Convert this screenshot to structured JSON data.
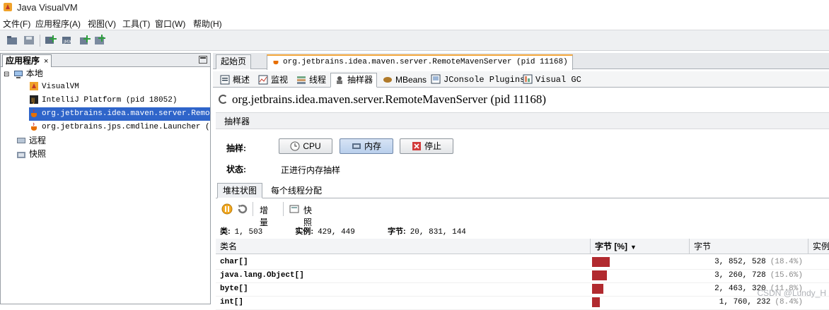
{
  "window": {
    "title": "Java VisualVM"
  },
  "menu": [
    "文件(F)",
    "应用程序(A)",
    "视图(V)",
    "工具(T)",
    "窗口(W)",
    "帮助(H)"
  ],
  "toolbar": {
    "icons": [
      "open-icon",
      "save-icon",
      "add-jmx-icon",
      "add-remote-icon",
      "add-coredump-icon",
      "add-snapshot-icon"
    ]
  },
  "left_panel": {
    "tab_label": "应用程序",
    "tree": {
      "local": "本地",
      "apps": [
        "VisualVM",
        "IntelliJ Platform (pid 18052)",
        "org.jetbrains.idea.maven.server.RemoteM",
        "org.jetbrains.jps.cmdline.Launcher (pid"
      ],
      "remote": "远程",
      "snapshots": "快照"
    }
  },
  "doc_tabs": [
    "起始页",
    "org.jetbrains.idea.maven.server.RemoteMavenServer (pid 11168)"
  ],
  "sub_tabs": [
    "概述",
    "监视",
    "线程",
    "抽样器",
    "MBeans",
    "JConsole Plugins",
    "Visual GC"
  ],
  "process_title": "org.jetbrains.idea.maven.server.RemoteMavenServer",
  "process_pid": "(pid 11168)",
  "section_title": "抽样器",
  "sampler": {
    "sample_label": "抽样:",
    "cpu_button": "CPU",
    "memory_button": "内存",
    "stop_button": "停止",
    "status_label": "状态:",
    "status_value": "正进行内存抽样"
  },
  "view_tabs": [
    "堆柱状图",
    "每个线程分配"
  ],
  "controls": {
    "delta_label": "增量",
    "snapshot_label": "快照"
  },
  "stats": {
    "classes_label": "类:",
    "classes_value": "1, 503",
    "instances_label": "实例:",
    "instances_value": "429, 449",
    "bytes_label": "字节:",
    "bytes_value": "20, 831, 144"
  },
  "table": {
    "headers": [
      "类名",
      "字节 [%]",
      "字节",
      "实例数"
    ],
    "rows": [
      {
        "name": "char[]",
        "percent": 18.4,
        "bytes": "3, 852, 528",
        "pct_label": "(18.4%)"
      },
      {
        "name": "java.lang.Object[]",
        "percent": 15.6,
        "bytes": "3, 260, 728",
        "pct_label": "(15.6%)"
      },
      {
        "name": "byte[]",
        "percent": 11.8,
        "bytes": "2, 463, 320",
        "pct_label": "(11.8%)"
      },
      {
        "name": "int[]",
        "percent": 8.4,
        "bytes": "1, 760, 232",
        "pct_label": "(8.4%)"
      }
    ]
  },
  "watermark": "CSDN @Lundy_H",
  "colors": {
    "selection": "#2f65ca",
    "bar": "#b12a2f",
    "active_tab_accent": "#f2a53a"
  }
}
